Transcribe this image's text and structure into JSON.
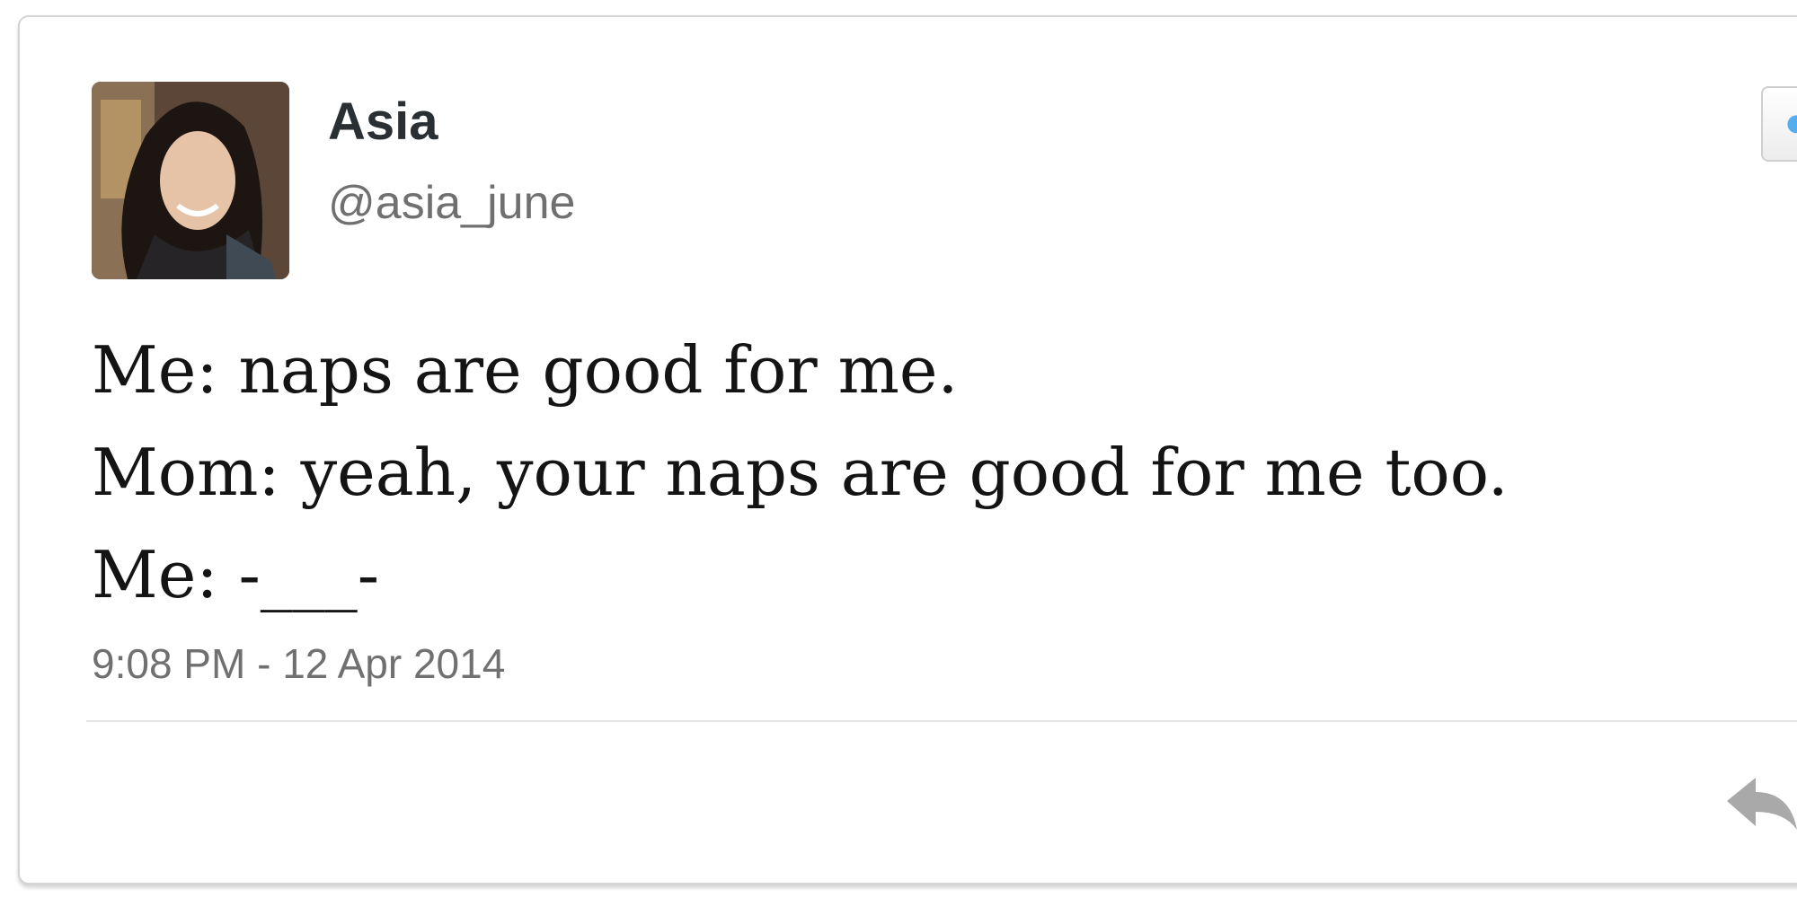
{
  "tweet": {
    "author": {
      "display_name": "Asia",
      "handle": "@asia_june"
    },
    "text_lines": [
      "Me: naps are good for me.",
      "Mom: yeah, your naps are good for me too.",
      "Me: -___-"
    ],
    "timestamp": "9:08 PM - 12 Apr 2014",
    "actions": {
      "follow_icon": "twitter-bird-icon",
      "reply_icon": "reply-arrow-icon"
    }
  },
  "colors": {
    "name": "#292f33",
    "muted": "#707070",
    "body_text": "#141414",
    "accent": "#55acee"
  }
}
